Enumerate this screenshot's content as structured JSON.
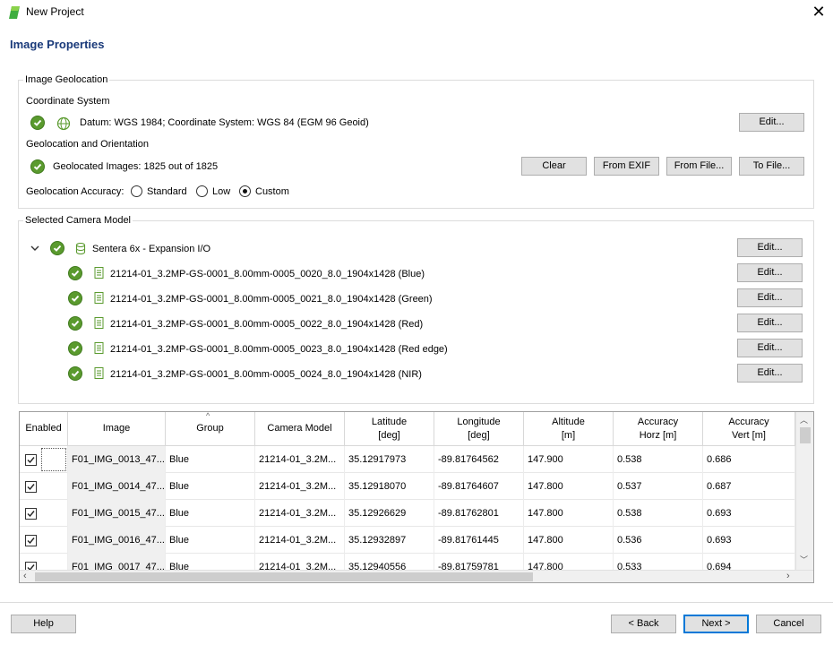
{
  "window": {
    "title": "New Project"
  },
  "page": {
    "title": "Image Properties"
  },
  "geolocation": {
    "group_label": "Image Geolocation",
    "coord_system_label": "Coordinate System",
    "coord_system_text": "Datum: WGS 1984; Coordinate System: WGS 84 (EGM 96 Geoid)",
    "edit_label": "Edit...",
    "geo_orientation_label": "Geolocation and Orientation",
    "geolocated_text": "Geolocated Images: 1825 out of 1825",
    "buttons": {
      "clear": "Clear",
      "from_exif": "From EXIF",
      "from_file": "From File...",
      "to_file": "To File..."
    },
    "accuracy_label": "Geolocation Accuracy:",
    "accuracy_options": [
      "Standard",
      "Low",
      "Custom"
    ],
    "accuracy_selected": "Custom"
  },
  "camera": {
    "group_label": "Selected Camera Model",
    "model_name": "Sentera 6x - Expansion I/O",
    "edit_label": "Edit...",
    "bands": [
      "21214-01_3.2MP-GS-0001_8.00mm-0005_0020_8.0_1904x1428 (Blue)",
      "21214-01_3.2MP-GS-0001_8.00mm-0005_0021_8.0_1904x1428 (Green)",
      "21214-01_3.2MP-GS-0001_8.00mm-0005_0022_8.0_1904x1428 (Red)",
      "21214-01_3.2MP-GS-0001_8.00mm-0005_0023_8.0_1904x1428 (Red edge)",
      "21214-01_3.2MP-GS-0001_8.00mm-0005_0024_8.0_1904x1428 (NIR)"
    ]
  },
  "table": {
    "headers": {
      "enabled": "Enabled",
      "image": "Image",
      "group": "Group",
      "camera_model": "Camera Model",
      "latitude": "Latitude\n[deg]",
      "longitude": "Longitude\n[deg]",
      "altitude": "Altitude\n[m]",
      "acc_horz": "Accuracy\nHorz [m]",
      "acc_vert": "Accuracy\nVert [m]"
    },
    "rows": [
      {
        "enabled": true,
        "image": "F01_IMG_0013_47...",
        "group": "Blue",
        "camera": "21214-01_3.2M...",
        "lat": "35.12917973",
        "lon": "-89.81764562",
        "alt": "147.900",
        "horz": "0.538",
        "vert": "0.686"
      },
      {
        "enabled": true,
        "image": "F01_IMG_0014_47...",
        "group": "Blue",
        "camera": "21214-01_3.2M...",
        "lat": "35.12918070",
        "lon": "-89.81764607",
        "alt": "147.800",
        "horz": "0.537",
        "vert": "0.687"
      },
      {
        "enabled": true,
        "image": "F01_IMG_0015_47...",
        "group": "Blue",
        "camera": "21214-01_3.2M...",
        "lat": "35.12926629",
        "lon": "-89.81762801",
        "alt": "147.800",
        "horz": "0.538",
        "vert": "0.693"
      },
      {
        "enabled": true,
        "image": "F01_IMG_0016_47...",
        "group": "Blue",
        "camera": "21214-01_3.2M...",
        "lat": "35.12932897",
        "lon": "-89.81761445",
        "alt": "147.800",
        "horz": "0.536",
        "vert": "0.693"
      },
      {
        "enabled": true,
        "image": "F01_IMG_0017_47...",
        "group": "Blue",
        "camera": "21214-01_3.2M...",
        "lat": "35.12940556",
        "lon": "-89.81759781",
        "alt": "147.800",
        "horz": "0.533",
        "vert": "0.694"
      }
    ]
  },
  "footer": {
    "help": "Help",
    "back": "< Back",
    "next": "Next >",
    "cancel": "Cancel"
  },
  "colors": {
    "title_blue": "#1a3a7a",
    "ok_green": "#5a9a2e",
    "primary_border": "#0078d7"
  }
}
